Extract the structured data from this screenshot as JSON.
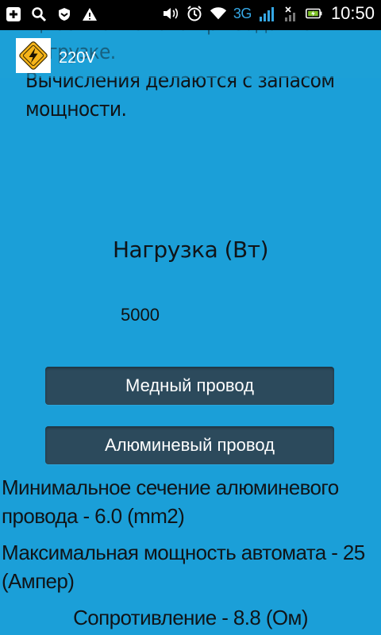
{
  "status_bar": {
    "network": "3G",
    "time": "10:50",
    "icons": [
      "plus-icon",
      "search-icon",
      "shield-icon",
      "warning-icon",
      "volume-icon",
      "alarm-icon",
      "wifi-icon",
      "signal-icon",
      "signal-x-icon",
      "battery-charging-icon"
    ]
  },
  "action_bar": {
    "title": "220V",
    "logo_icon": "lightning-warning-icon"
  },
  "description": "щность автомата при заданной\nнагрузке.\n Вычисления делаются с запасом\nмощности.",
  "load": {
    "label": "Нагрузка (Вт)",
    "value": "5000"
  },
  "buttons": {
    "copper": "Медный провод",
    "aluminum": "Алюминевый провод"
  },
  "results": {
    "cross_section": "Минимальное сечение алюминевого провода - 6.0 (mm2)",
    "breaker": "Максимальная мощность автомата - 25 (Ампер)",
    "resistance": "Сопротивление - 8.8 (Ом)"
  },
  "colors": {
    "background": "#1B9FD8",
    "button": "#2C4A5C",
    "logo_yellow": "#F5B41A"
  }
}
